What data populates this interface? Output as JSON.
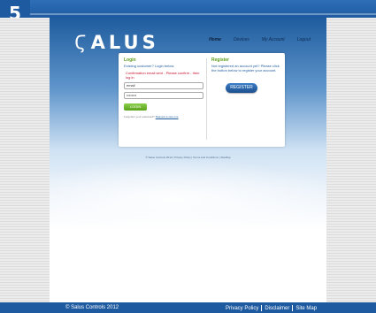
{
  "step": {
    "number": "5"
  },
  "site": {
    "logo_text": "SALUS",
    "logo_mark": "S",
    "nav": [
      "Home",
      "Devices",
      "My Account",
      "Logout"
    ]
  },
  "login": {
    "heading": "Login",
    "subheading": "Existing customer? Login below.",
    "error": "Confirmation email sent - Please confirm - then log in",
    "email_value": "email",
    "password_value": "••••••••",
    "button": "LOGIN",
    "forgot_text": "Forgotten your password?",
    "forgot_link": "Request a new one"
  },
  "register": {
    "heading": "Register",
    "text": "Not registered an account yet? Please click the button below to register your account.",
    "button": "REGISTER"
  },
  "site_footer": "© Salus Controls 2012 | Privacy Policy | Terms and Conditions | SiteMap",
  "footer": {
    "copyright": "© Salus Controls 2012",
    "links": [
      "Privacy Policy",
      "Disclaimer",
      "Site Map"
    ]
  }
}
